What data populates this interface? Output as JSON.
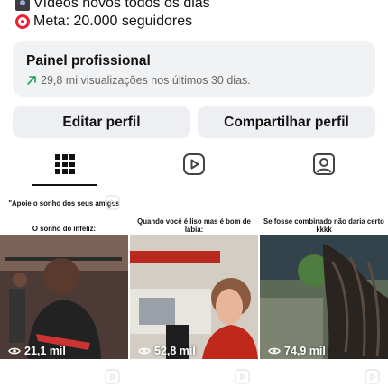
{
  "bio": {
    "line1": "Vídeos novos todos os dias",
    "line2": "Meta: 20.000 seguidores",
    "line1_icon": "camera-emoji-icon",
    "line2_icon": "target-emoji-icon"
  },
  "pro_panel": {
    "title": "Painel profissional",
    "subtitle": "29,8 mi visualizações nos últimos 30 dias.",
    "icon": "trend-up-arrow-icon",
    "accent_color": "#1aa05a"
  },
  "actions": {
    "edit_label": "Editar perfil",
    "share_label": "Compartilhar perfil"
  },
  "tabs": [
    {
      "name": "grid",
      "icon": "grid-icon",
      "active": true
    },
    {
      "name": "reels",
      "icon": "reels-icon",
      "active": false
    },
    {
      "name": "tagged",
      "icon": "tagged-person-icon",
      "active": false
    }
  ],
  "posts": [
    {
      "caption_top": "\"Apoie o sonho dos seus amigos",
      "caption_bottom": "O sonho do infeliz:",
      "views": "21,1 mil"
    },
    {
      "caption_top": "Quando você é liso mas é bom de lábia:",
      "caption_bottom": "",
      "views": "52,8 mil"
    },
    {
      "caption_top": "Se fosse combinado não daria certo kkkk",
      "caption_bottom": "",
      "views": "74,9 mil"
    }
  ]
}
